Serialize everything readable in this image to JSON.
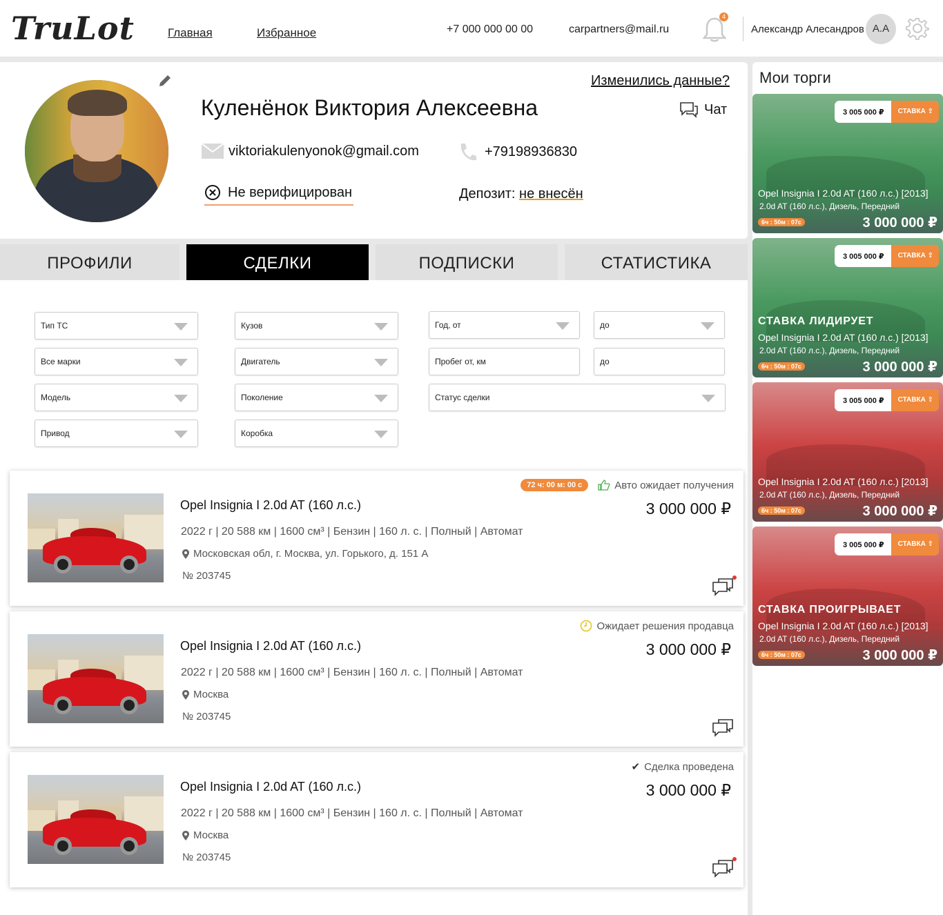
{
  "header": {
    "logo": "TruLot",
    "nav": [
      "Главная",
      "Избранное"
    ],
    "phone": "+7 000 000 00 00",
    "email": "carpartners@mail.ru",
    "notifications_count": "4",
    "user_name": "Александр Алесандров",
    "user_initials": "А.А"
  },
  "profile": {
    "full_name": "Куленёнок Виктория Алексеевна",
    "changed_link": "Изменились данные?",
    "chat_label": "Чат",
    "email": "viktoriakulenyonok@gmail.com",
    "phone": "+79198936830",
    "verification": "Не верифицирован",
    "deposit_label": "Депозит:",
    "deposit_value": "не внесён"
  },
  "tabs": [
    {
      "label": "ПРОФИЛИ",
      "active": false
    },
    {
      "label": "СДЕЛКИ",
      "active": true
    },
    {
      "label": "ПОДПИСКИ",
      "active": false
    },
    {
      "label": "СТАТИСТИКА",
      "active": false
    }
  ],
  "filters": {
    "vehicle_type": "Тип ТС",
    "brands": "Все марки",
    "model": "Модель",
    "drive": "Привод",
    "body": "Кузов",
    "engine": "Двигатель",
    "generation": "Поколение",
    "gearbox": "Коробка",
    "year_from": "Год, от",
    "year_to": "до",
    "mileage_from": "Пробег от, км",
    "mileage_to": "до",
    "deal_status": "Статус сделки"
  },
  "deals": [
    {
      "title": "Opel Insignia I 2.0d AT (160 л.с.)",
      "price": "3 000 000 ₽",
      "specs": "2022 г  |  20 588 км  |  1600 см³  |  Бензин  |  160 л. с.  |  Полный  |  Автомат",
      "location": "Московская обл, г. Москва, ул. Горького, д. 151 А",
      "number": "№ 203745",
      "timer": "72 ч: 00 м: 00 с",
      "status": "Авто ожидает получения"
    },
    {
      "title": "Opel Insignia I 2.0d AT (160 л.с.)",
      "price": "3 000 000 ₽",
      "specs": "2022 г  |  20 588 км  |  1600 см³  |  Бензин  |  160 л. с.  |  Полный  |  Автомат",
      "location": "Москва",
      "number": "№ 203745",
      "status": "Ожидает решения продавца"
    },
    {
      "title": "Opel Insignia I 2.0d AT (160 л.с.)",
      "price": "3 000 000 ₽",
      "specs": "2022 г  |  20 588 км  |  1600 см³  |  Бензин  |  160 л. с.  |  Полный  |  Автомат",
      "location": "Москва",
      "number": "№ 203745",
      "status": "Сделка проведена"
    }
  ],
  "bids_panel": {
    "title": "Мои торги",
    "items": [
      {
        "amount": "3 005 000 ₽",
        "stake": "СТАВКА",
        "state": "",
        "car": "Opel Insignia I 2.0d AT (160 л.с.) [2013]",
        "spec": "2.0d AT (160 л.с.), Дизель, Передний",
        "timer": "6ч : 50м : 07с",
        "price": "3 000 000 ₽",
        "color": "green"
      },
      {
        "amount": "3 005 000 ₽",
        "stake": "СТАВКА",
        "state": "СТАВКА  ЛИДИРУЕТ",
        "car": "Opel Insignia I 2.0d AT (160 л.с.) [2013]",
        "spec": "2.0d AT (160 л.с.), Дизель, Передний",
        "timer": "6ч : 50м : 07с",
        "price": "3 000 000 ₽",
        "color": "green"
      },
      {
        "amount": "3 005 000 ₽",
        "stake": "СТАВКА",
        "state": "",
        "car": "Opel Insignia I 2.0d AT (160 л.с.) [2013]",
        "spec": "2.0d AT (160 л.с.), Дизель, Передний",
        "timer": "6ч : 50м : 07с",
        "price": "3 000 000 ₽",
        "color": "red"
      },
      {
        "amount": "3 005 000 ₽",
        "stake": "СТАВКА",
        "state": "СТАВКА  ПРОИГРЫВАЕТ",
        "car": "Opel Insignia I 2.0d AT (160 л.с.) [2013]",
        "spec": "2.0d AT (160 л.с.), Дизель, Передний",
        "timer": "6ч : 50м : 07с",
        "price": "3 000 000 ₽",
        "color": "red"
      }
    ]
  },
  "colors": {
    "accent": "#f08a3c",
    "active_tab": "#000000",
    "bid_green": "#4a9a60",
    "bid_red": "#cc4444"
  }
}
